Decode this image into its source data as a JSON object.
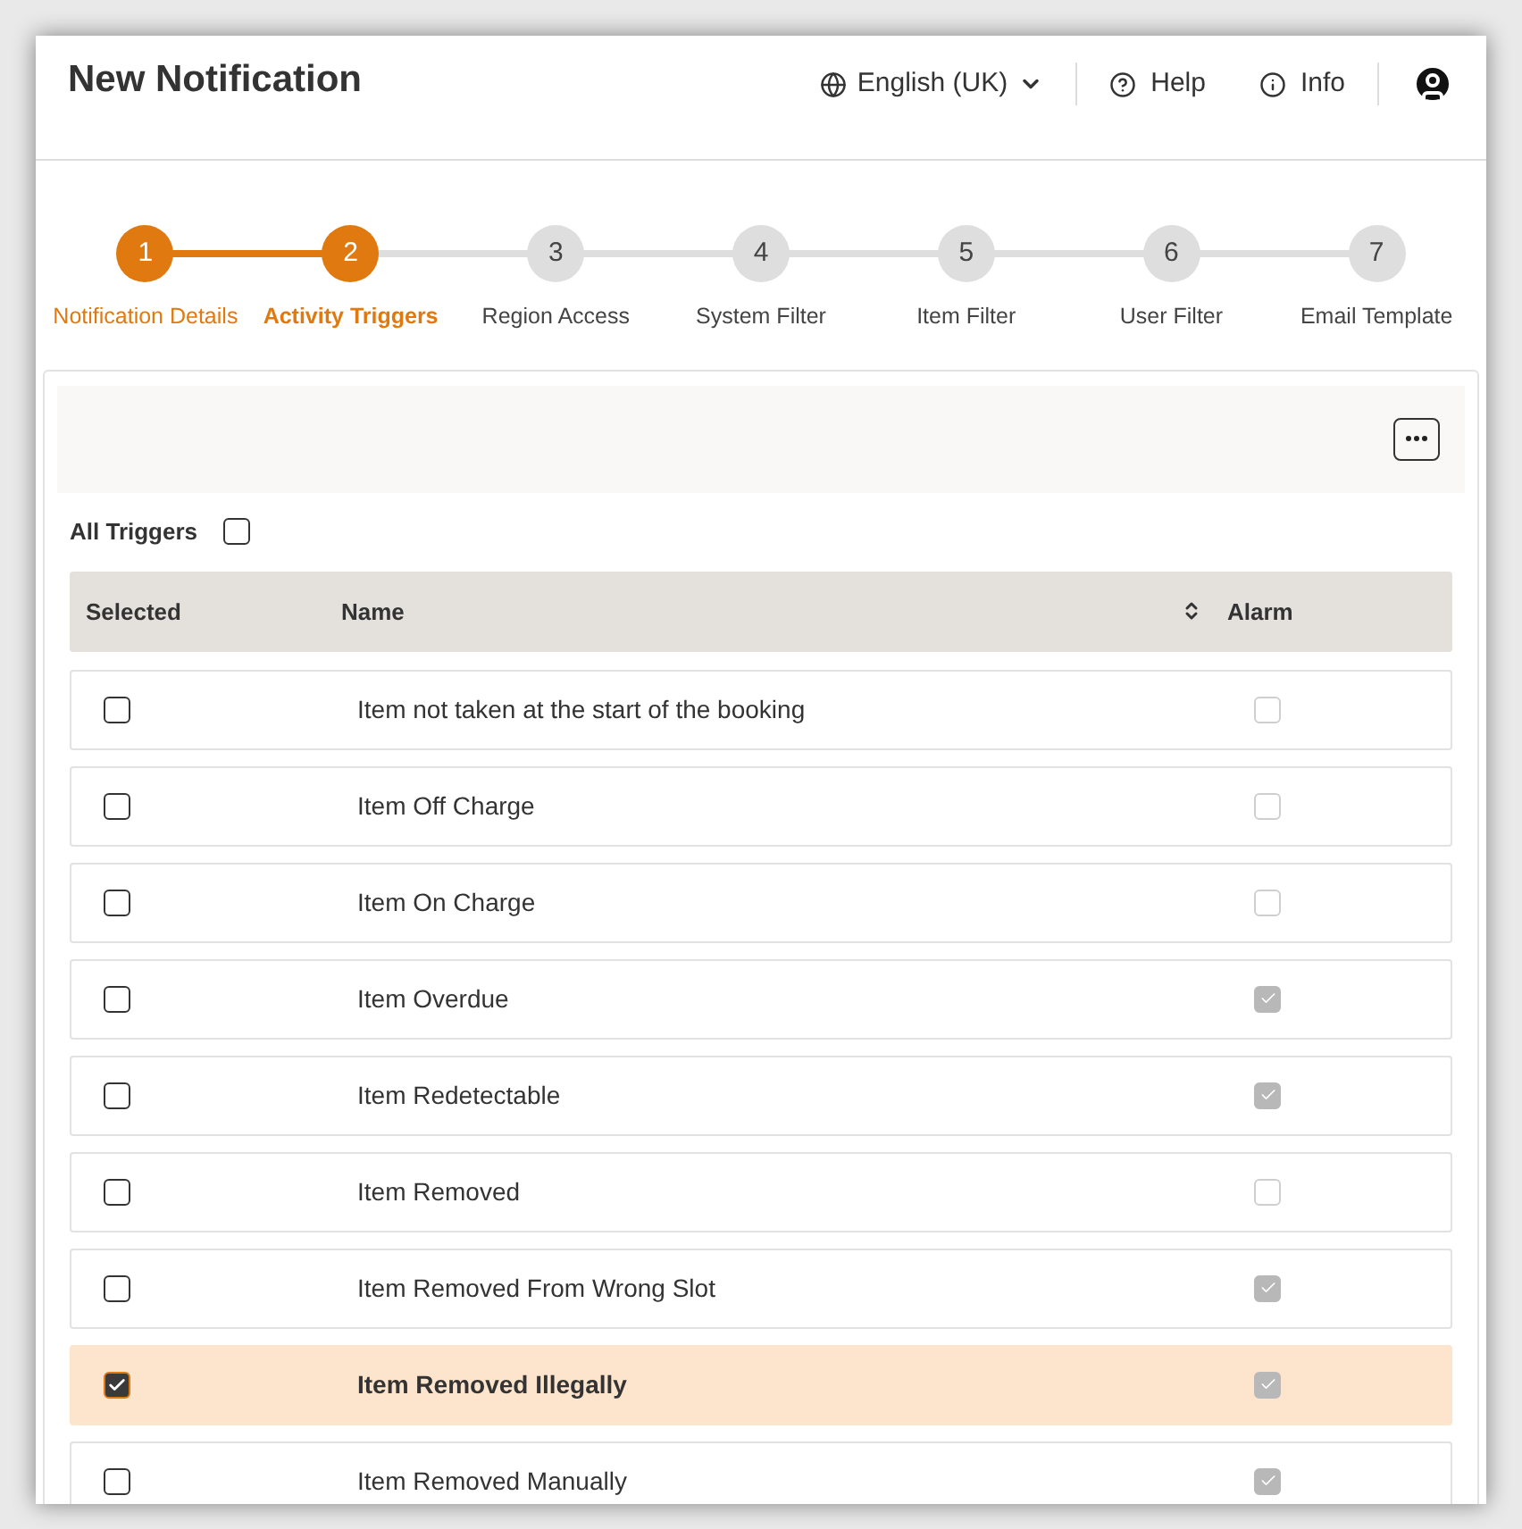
{
  "header": {
    "title": "New Notification",
    "language": "English (UK)",
    "help": "Help",
    "info": "Info"
  },
  "steps": [
    {
      "number": "1",
      "label": "Notification Details",
      "kind": "done"
    },
    {
      "number": "2",
      "label": "Activity Triggers",
      "kind": "current"
    },
    {
      "number": "3",
      "label": "Region Access",
      "kind": "pending"
    },
    {
      "number": "4",
      "label": "System Filter",
      "kind": "pending"
    },
    {
      "number": "5",
      "label": "Item Filter",
      "kind": "pending"
    },
    {
      "number": "6",
      "label": "User Filter",
      "kind": "pending"
    },
    {
      "number": "7",
      "label": "Email Template",
      "kind": "pending"
    }
  ],
  "all_triggers": {
    "label": "All Triggers",
    "checked": false
  },
  "table": {
    "columns": [
      "Selected",
      "Name",
      "Alarm"
    ],
    "rows": [
      {
        "name": "Item not taken at the start of the booking",
        "checked": false,
        "alarm": false
      },
      {
        "name": "Item Off Charge",
        "checked": false,
        "alarm": false
      },
      {
        "name": "Item On Charge",
        "checked": false,
        "alarm": false
      },
      {
        "name": "Item Overdue",
        "checked": false,
        "alarm": true
      },
      {
        "name": "Item Redetectable",
        "checked": false,
        "alarm": true
      },
      {
        "name": "Item Removed",
        "checked": false,
        "alarm": false
      },
      {
        "name": "Item Removed From Wrong Slot",
        "checked": false,
        "alarm": true
      },
      {
        "name": "Item Removed Illegally",
        "checked": true,
        "alarm": true
      },
      {
        "name": "Item Removed Manually",
        "checked": false,
        "alarm": true
      }
    ]
  }
}
